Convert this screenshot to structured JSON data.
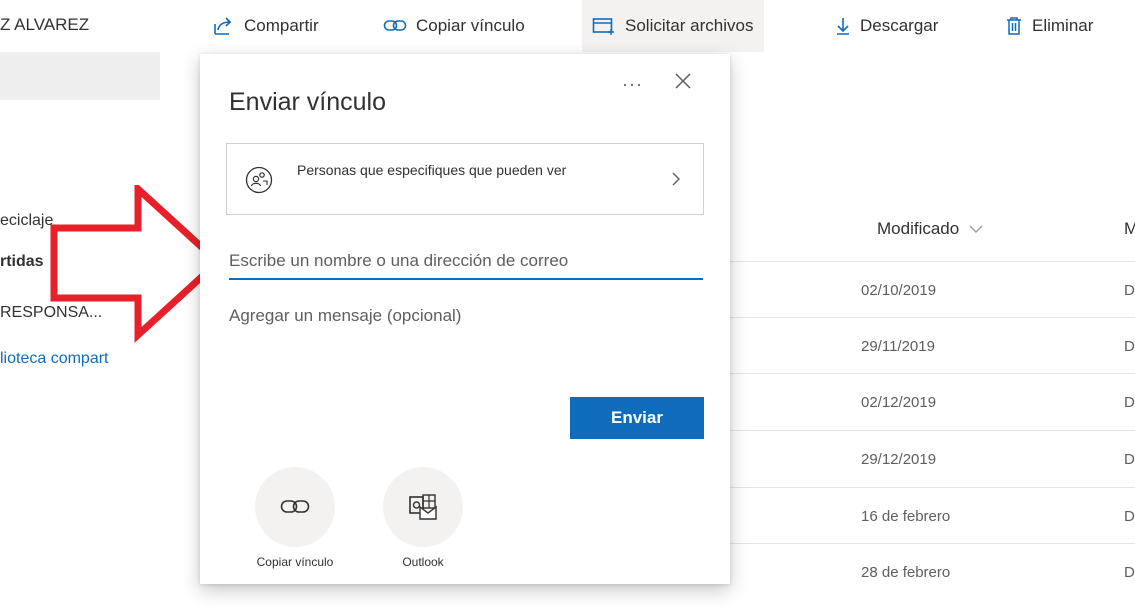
{
  "user": {
    "name": "Z ALVAREZ"
  },
  "toolbar": {
    "share_label": "Compartir",
    "copy_link_label": "Copiar vínculo",
    "request_files_label": "Solicitar archivos",
    "download_label": "Descargar",
    "delete_label": "Eliminar"
  },
  "nav": {
    "items": [
      {
        "label": "eciclaje"
      },
      {
        "label": "rtidas"
      },
      {
        "label": "RESPONSA..."
      },
      {
        "label": "lioteca compart"
      }
    ]
  },
  "dialog": {
    "title": "Enviar vínculo",
    "more_label": "···",
    "permission_text": "Personas que especifiques que pueden ver",
    "to_placeholder": "Escribe un nombre o una dirección de correo",
    "message_placeholder": "Agregar un mensaje (opcional)",
    "send_label": "Enviar",
    "options": [
      {
        "label": "Copiar vínculo",
        "icon": "link-icon"
      },
      {
        "label": "Outlook",
        "icon": "outlook-icon"
      }
    ]
  },
  "list": {
    "modified_header": "Modificado",
    "next_header": "M",
    "rows": [
      {
        "modified": "02/10/2019",
        "by": "D"
      },
      {
        "modified": "29/11/2019",
        "by": "D"
      },
      {
        "modified": "02/12/2019",
        "by": "D"
      },
      {
        "modified": "29/12/2019",
        "by": "D"
      },
      {
        "modified": "16 de febrero",
        "by": "D"
      },
      {
        "modified": "28 de febrero",
        "by": "D"
      }
    ]
  },
  "colors": {
    "accent": "#0f6cbd",
    "annotation_arrow": "#e8202a"
  }
}
